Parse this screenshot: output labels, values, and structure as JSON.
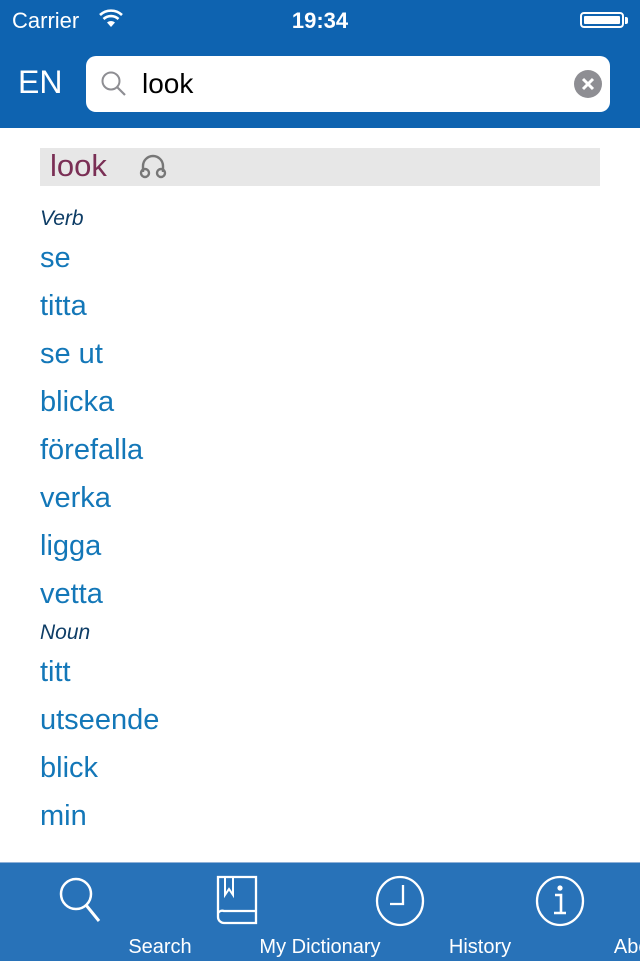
{
  "status_bar": {
    "carrier": "Carrier",
    "time": "19:34",
    "battery_percent": 100
  },
  "header": {
    "language": "EN"
  },
  "search": {
    "value": "look",
    "placeholder": ""
  },
  "entry": {
    "headword": "look",
    "sections": [
      {
        "pos": "Verb",
        "translations": [
          "se",
          "titta",
          "se ut",
          "blicka",
          "förefalla",
          "verka",
          "ligga",
          "vetta"
        ]
      },
      {
        "pos": "Noun",
        "translations": [
          "titt",
          "utseende",
          "blick",
          "min"
        ]
      }
    ]
  },
  "tabs": [
    {
      "label": "Search",
      "icon": "search-icon"
    },
    {
      "label": "My Dictionary",
      "icon": "book-icon"
    },
    {
      "label": "History",
      "icon": "clock-icon"
    },
    {
      "label": "About",
      "icon": "info-icon"
    }
  ],
  "colors": {
    "header_bg": "#0e63b0",
    "tabbar_bg": "#2872b8",
    "headword": "#7a2f55",
    "translation": "#1377b8",
    "pos": "#0e3d66"
  }
}
